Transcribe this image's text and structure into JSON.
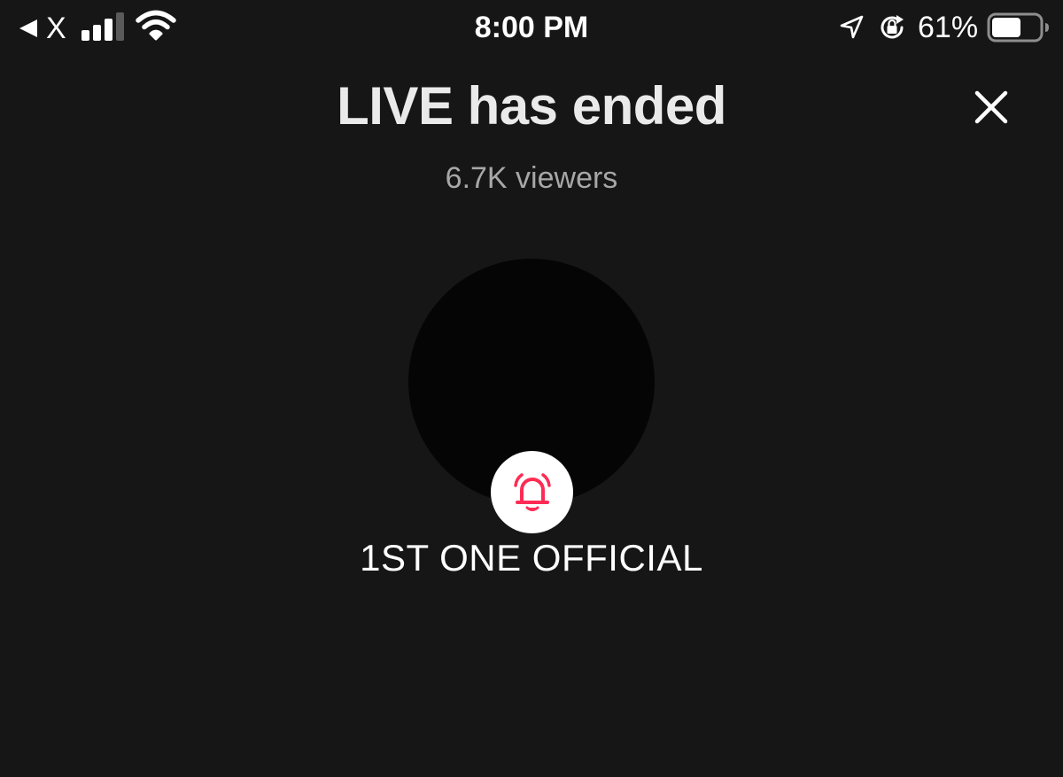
{
  "status_bar": {
    "back_app_label": "X",
    "time": "8:00 PM",
    "battery_percent": "61%",
    "battery_level": 0.61,
    "icons": [
      "back-arrow-icon",
      "signal-icon",
      "wifi-icon",
      "location-icon",
      "rotation-lock-icon",
      "battery-icon"
    ]
  },
  "header": {
    "title": "LIVE has ended",
    "viewers": "6.7K viewers",
    "close_icon": "close-icon"
  },
  "host": {
    "name": "1ST ONE OFFICIAL",
    "follow_icon": "bell-icon"
  },
  "colors": {
    "background": "#161616",
    "avatar": "#050505",
    "accent": "#fe2c55",
    "text_primary": "#eaeaea",
    "text_secondary": "#a7a7a7"
  }
}
